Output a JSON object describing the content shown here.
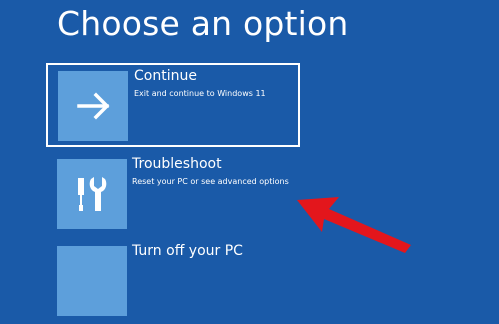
{
  "page": {
    "title": "Choose an option"
  },
  "options": [
    {
      "label": "Continue",
      "description": "Exit and continue to Windows 11",
      "icon": "arrow-right-icon",
      "selected": true
    },
    {
      "label": "Troubleshoot",
      "description": "Reset your PC or see advanced options",
      "icon": "tools-icon",
      "selected": false
    },
    {
      "label": "Turn off your PC",
      "description": "",
      "icon": "power-icon",
      "selected": false
    }
  ],
  "colors": {
    "background": "#1a5aa8",
    "tile": "#5d9fdb",
    "annotation_arrow": "#e3161c"
  }
}
